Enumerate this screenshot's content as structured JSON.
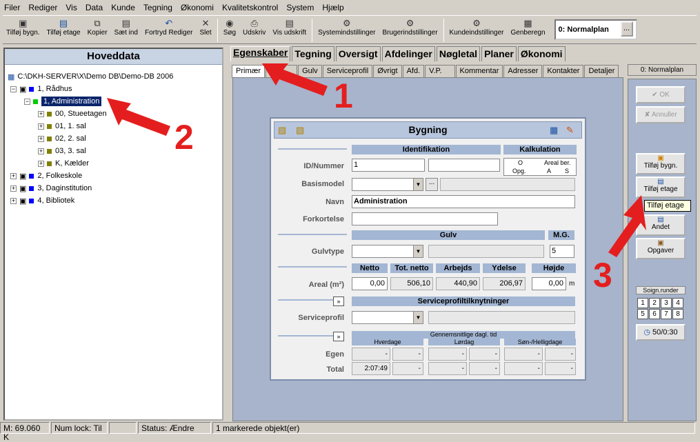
{
  "menu": [
    "Filer",
    "Rediger",
    "Vis",
    "Data",
    "Kunde",
    "Tegning",
    "Økonomi",
    "Kvalitetskontrol",
    "System",
    "Hjælp"
  ],
  "toolbar": {
    "group1": [
      "Tilføj bygn.",
      "Tilføj etage",
      "Kopier",
      "Sæt ind",
      "Fortryd Rediger",
      "Slet"
    ],
    "group2": [
      "Søg",
      "Udskriv",
      "Vis udskrift"
    ],
    "group3": [
      "Systemindstillinger",
      "Brugerindstillinger"
    ],
    "group4": [
      "Kundeindstillinger",
      "Genberegn"
    ],
    "plan": "0: Normalplan",
    "plan_btn": "..."
  },
  "left": {
    "title": "Hoveddata",
    "root": "C:\\DKH-SERVER\\X\\Demo DB\\Demo-DB 2006",
    "n1": "1, Rådhus",
    "n11": "1, Administration",
    "f1": "00, Stueetagen",
    "f2": "01, 1. sal",
    "f3": "02, 2. sal",
    "f4": "03, 3. sal",
    "f5": "K, Kælder",
    "n2": "2, Folkeskole",
    "n3": "3, Daginstitution",
    "n4": "4, Bibliotek"
  },
  "tabs": [
    "Egenskaber",
    "Tegning",
    "Oversigt",
    "Afdelinger",
    "Nøgletal",
    "Planer",
    "Økonomi"
  ],
  "subtabs": [
    "Primær",
    "",
    "Gulv",
    "Serviceprofil",
    "Øvrigt",
    "Afd.",
    "V.P.",
    "Kommentar",
    "Adresser",
    "Kontakter",
    "Detaljer"
  ],
  "normtab": "0: Normalplan",
  "dlg": {
    "title": "Bygning",
    "identifikation": "Identifikation",
    "kalkulation": "Kalkulation",
    "k_o": "O",
    "k_areal": "Areal ber.",
    "k_opg": "Opg.",
    "k_a": "A",
    "k_s": "S",
    "l_id": "ID/Nummer",
    "v_id": "1",
    "l_basis": "Basismodel",
    "basis_btn": "...",
    "l_navn": "Navn",
    "v_navn": "Administration",
    "l_fork": "Forkortelse",
    "gulv": "Gulv",
    "mg": "M.G.",
    "l_gulvtype": "Gulvtype",
    "v_mg": "5",
    "netto": "Netto",
    "totnetto": "Tot. netto",
    "arbejds": "Arbejds",
    "ydelse": "Ydelse",
    "hojde": "Højde",
    "l_areal": "Areal (m²)",
    "v_netto": "0,00",
    "v_totnetto": "506,10",
    "v_arbejds": "440,90",
    "v_ydelse": "206,97",
    "v_hojde": "0,00",
    "unit_m": "m",
    "spk": "Serviceprofiltilknytninger",
    "l_sp": "Serviceprofil",
    "gdt": "Gennemsnitlige dagl. tid",
    "hverdage": "Hverdage",
    "lordag": "Lørdag",
    "sonhel": "Søn-/Helligdage",
    "l_egen": "Egen",
    "l_total": "Total",
    "v_total": "2:07:49",
    "dash": "-"
  },
  "right": {
    "ok": "OK",
    "annuller": "Annuller",
    "tilfoj_bygn": "Tilføj bygn.",
    "tilfoj_etage": "Tilføj etage",
    "tooltip": "Tilføj etage",
    "andet": "Andet",
    "opgaver": "Opgaver",
    "soign": "Soign.runder",
    "grid": [
      "1",
      "2",
      "3",
      "4",
      "5",
      "6",
      "7",
      "8"
    ],
    "counter": "50/0:30"
  },
  "status": [
    "M: 69.060 K",
    "Num lock: Til",
    "",
    "Status: Ændre",
    "1 markerede objekt(er)"
  ],
  "annot": {
    "n1": "1",
    "n2": "2",
    "n3": "3"
  },
  "colors": {
    "blue_panel": "#a7b4cc",
    "arrow": "#e41e1e"
  }
}
